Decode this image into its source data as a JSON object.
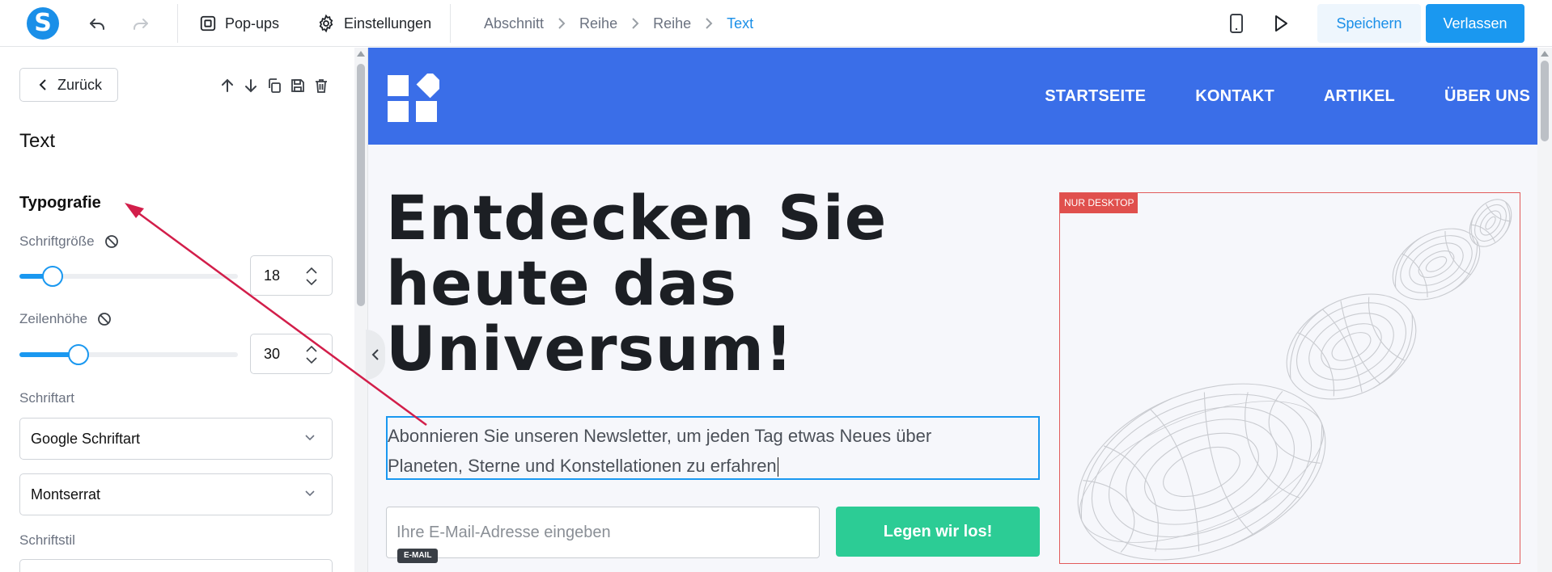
{
  "topbar": {
    "logo_letter": "S",
    "popups_label": "Pop-ups",
    "settings_label": "Einstellungen",
    "breadcrumbs": [
      "Abschnitt",
      "Reihe",
      "Reihe",
      "Text"
    ],
    "save_label": "Speichern",
    "exit_label": "Verlassen",
    "icons": [
      "undo-icon",
      "redo-icon",
      "popups-icon",
      "gear-icon",
      "mobile-icon",
      "play-icon"
    ]
  },
  "panel": {
    "back_label": "Zurück",
    "title": "Text",
    "section": "Typografie",
    "font_size": {
      "label": "Schriftgröße",
      "value": "18",
      "slider_fraction": 0.15
    },
    "line_height": {
      "label": "Zeilenhöhe",
      "value": "30",
      "slider_fraction": 0.27
    },
    "font_type": {
      "label": "Schriftart",
      "source": "Google Schriftart",
      "family": "Montserrat"
    },
    "font_style": {
      "label": "Schriftstil"
    }
  },
  "site": {
    "nav": [
      "STARTSEITE",
      "KONTAKT",
      "ARTIKEL",
      "ÜBER UNS"
    ],
    "hero_title_lines": [
      "Entdecken Sie",
      "heute das",
      "Universum!"
    ],
    "hero_text": "Abonnieren Sie unseren Newsletter, um jeden Tag etwas Neues über Planeten, Sterne und Konstellationen zu erfahren",
    "email_placeholder": "Ihre E-Mail-Adresse eingeben",
    "email_tag": "E-MAIL",
    "cta_label": "Legen wir los!",
    "desktop_only_tag": "NUR DESKTOP"
  },
  "colors": {
    "accent": "#1a98f0",
    "site_header": "#3a6ee8",
    "cta": "#2ccc95",
    "desktop_tag": "#e0504d",
    "annotation_arrow": "#d21e4a"
  }
}
